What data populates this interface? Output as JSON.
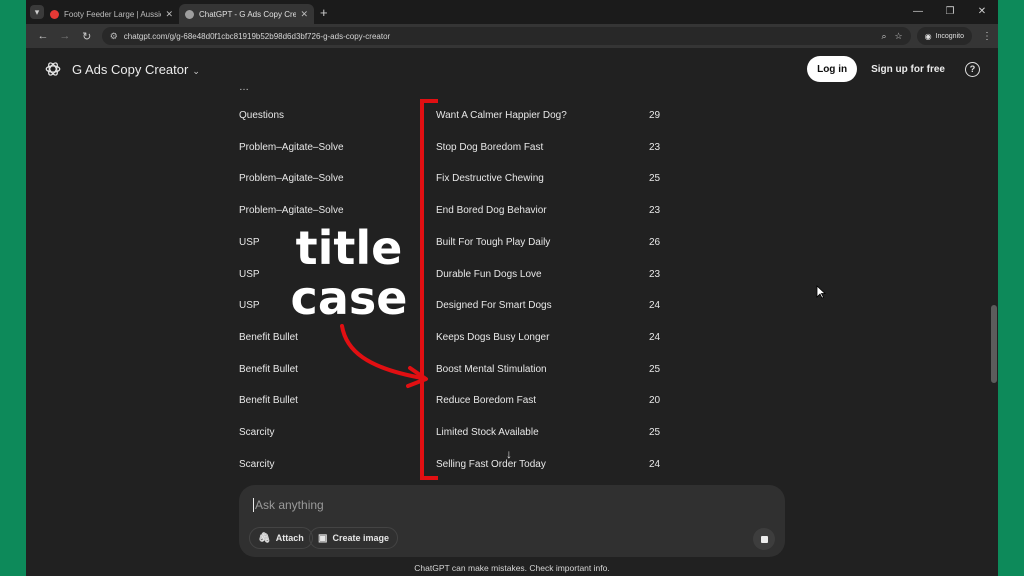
{
  "browser": {
    "tabs": [
      {
        "title": "Footy Feeder Large | Aussie Dog",
        "favicon_color": "#e53935"
      },
      {
        "title": "ChatGPT - G Ads Copy Creator",
        "favicon_color": "#9e9e9e"
      }
    ],
    "url": "chatgpt.com/g/g-68e48d0f1cbc81919b52b98d6d3bf726-g-ads-copy-creator",
    "incognito_label": "Incognito"
  },
  "header": {
    "app_title": "G Ads Copy Creator",
    "login_label": "Log in",
    "signup_label": "Sign up for free",
    "help_label": "?"
  },
  "table": {
    "partial_top_row": "…",
    "rows": [
      {
        "type": "Questions",
        "headline": "Want A Calmer Happier Dog?",
        "chars": "29"
      },
      {
        "type": "Problem–Agitate–Solve",
        "headline": "Stop Dog Boredom Fast",
        "chars": "23"
      },
      {
        "type": "Problem–Agitate–Solve",
        "headline": "Fix Destructive Chewing",
        "chars": "25"
      },
      {
        "type": "Problem–Agitate–Solve",
        "headline": "End Bored Dog Behavior",
        "chars": "23"
      },
      {
        "type": "USP",
        "headline": "Built For Tough Play Daily",
        "chars": "26"
      },
      {
        "type": "USP",
        "headline": "Durable Fun Dogs Love",
        "chars": "23"
      },
      {
        "type": "USP",
        "headline": "Designed For Smart Dogs",
        "chars": "24"
      },
      {
        "type": "Benefit Bullet",
        "headline": "Keeps Dogs Busy Longer",
        "chars": "24"
      },
      {
        "type": "Benefit Bullet",
        "headline": "Boost Mental Stimulation",
        "chars": "25"
      },
      {
        "type": "Benefit Bullet",
        "headline": "Reduce Boredom Fast",
        "chars": "20"
      },
      {
        "type": "Scarcity",
        "headline": "Limited Stock Available",
        "chars": "25"
      },
      {
        "type": "Scarcity",
        "headline": "Selling Fast Order Today",
        "chars": "24"
      }
    ]
  },
  "annotation": {
    "line1": "title",
    "line2": "case",
    "color": "#e10f12"
  },
  "composer": {
    "placeholder": "Ask anything",
    "attach_label": "Attach",
    "create_image_label": "Create image"
  },
  "footer": {
    "note": "ChatGPT can make mistakes. Check important info."
  }
}
